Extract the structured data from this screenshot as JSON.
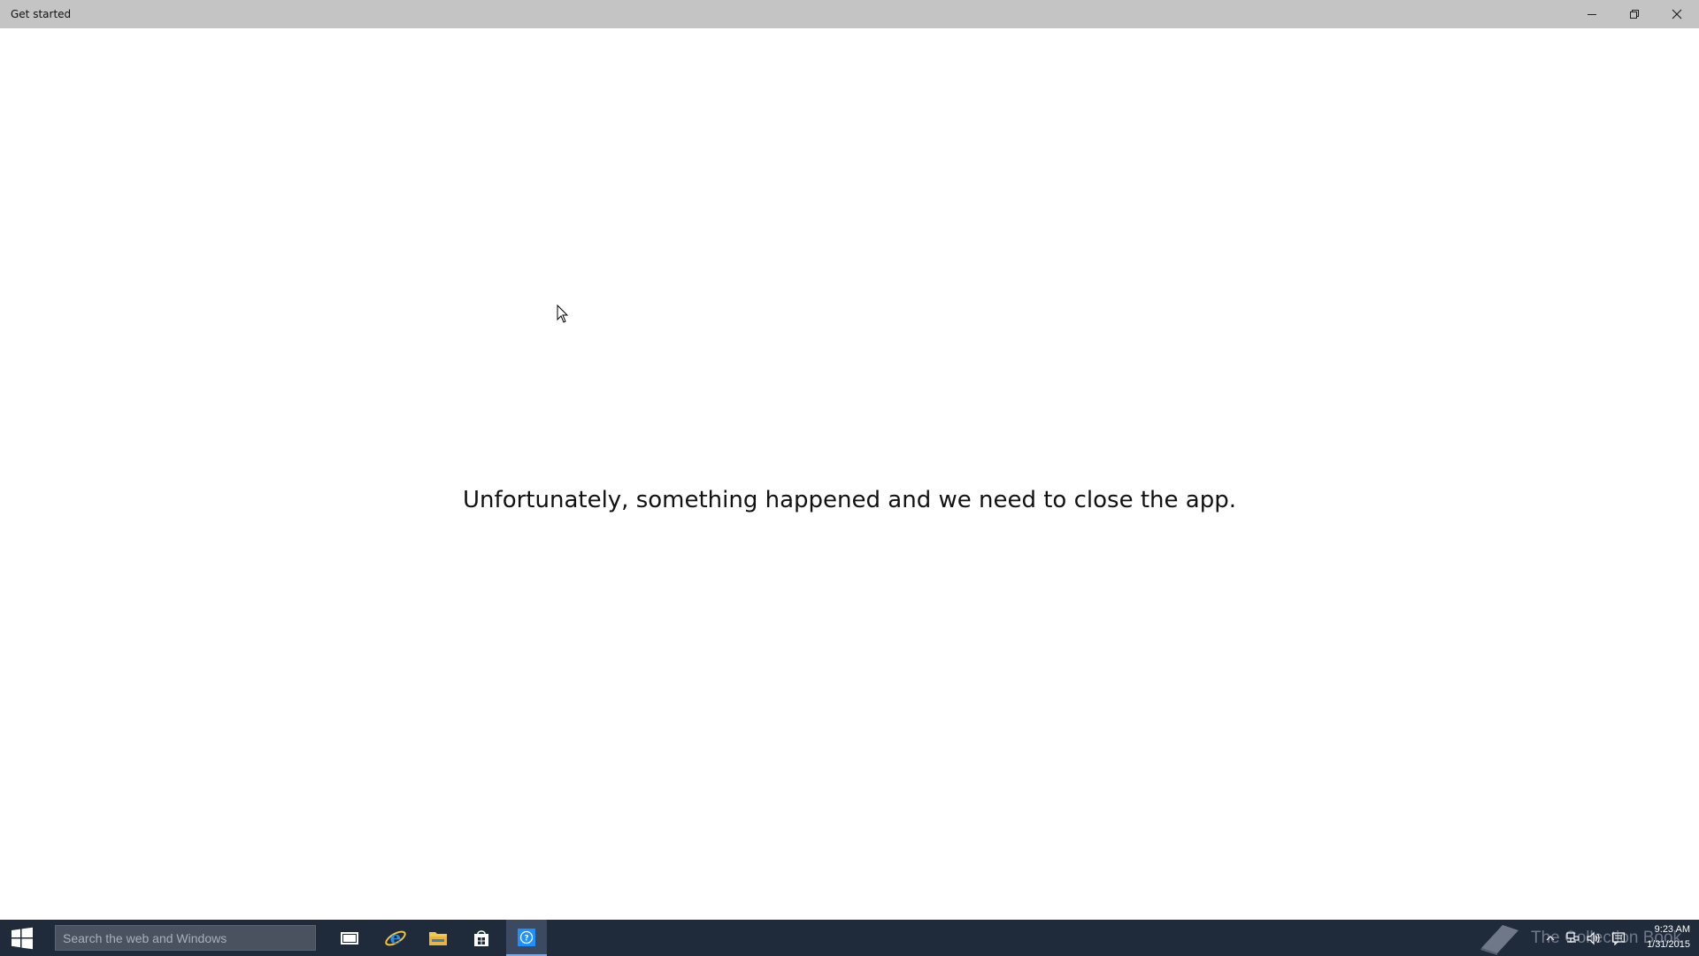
{
  "window": {
    "title": "Get started"
  },
  "content": {
    "error_message": "Unfortunately, something happened and we need to close the app."
  },
  "taskbar": {
    "search_placeholder": "Search the web and Windows",
    "pinned_apps": [
      "task-view",
      "internet-explorer",
      "file-explorer",
      "store",
      "get-started"
    ],
    "active_app": "Get started",
    "watermark_text": "The Collection Book",
    "clock": {
      "time": "9:23 AM",
      "date": "1/31/2015"
    }
  },
  "colors": {
    "titlebar": "#c4c4c4",
    "taskbar": "#1f2a3a",
    "accent": "#1e90ff",
    "content_bg": "#ffffff"
  }
}
